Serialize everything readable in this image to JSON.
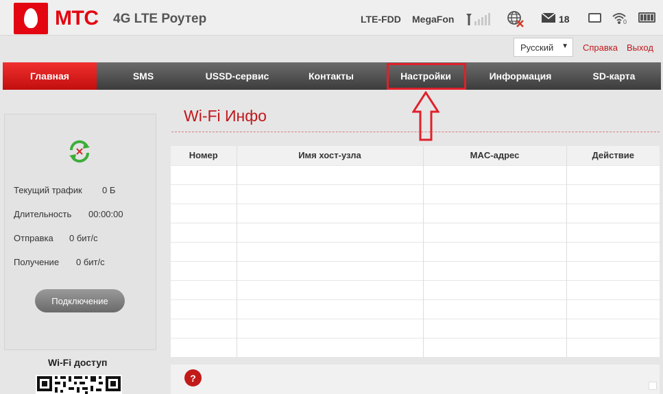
{
  "header": {
    "brand": "МТС",
    "product": "4G LTE Роутер",
    "network_type": "LTE-FDD",
    "operator": "MegaFon",
    "message_count": "18",
    "wifi_clients": "0"
  },
  "top_links": {
    "language": "Русский",
    "help": "Справка",
    "exit": "Выход"
  },
  "nav": {
    "items": [
      {
        "label": "Главная",
        "active": true
      },
      {
        "label": "SMS",
        "active": false
      },
      {
        "label": "USSD-сервис",
        "active": false
      },
      {
        "label": "Контакты",
        "active": false
      },
      {
        "label": "Настройки",
        "active": false
      },
      {
        "label": "Информация",
        "active": false
      },
      {
        "label": "SD-карта",
        "active": false
      }
    ]
  },
  "left_panel": {
    "stats": [
      {
        "label": "Текущий трафик",
        "value": "0 Б"
      },
      {
        "label": "Длительность",
        "value": "00:00:00"
      },
      {
        "label": "Отправка",
        "value": "0 бит/с"
      },
      {
        "label": "Получение",
        "value": "0 бит/с"
      }
    ],
    "connect_button": "Подключение",
    "wifi_access": "Wi-Fi доступ"
  },
  "main": {
    "title": "Wi-Fi Инфо",
    "table": {
      "columns": [
        "Номер",
        "Имя хост-узла",
        "MAC-адрес",
        "Действие"
      ],
      "rows": [
        [
          "",
          "",
          "",
          ""
        ],
        [
          "",
          "",
          "",
          ""
        ],
        [
          "",
          "",
          "",
          ""
        ],
        [
          "",
          "",
          "",
          ""
        ],
        [
          "",
          "",
          "",
          ""
        ],
        [
          "",
          "",
          "",
          ""
        ],
        [
          "",
          "",
          "",
          ""
        ],
        [
          "",
          "",
          "",
          ""
        ],
        [
          "",
          "",
          "",
          ""
        ],
        [
          "",
          "",
          "",
          ""
        ]
      ]
    },
    "help_icon_text": "?"
  },
  "colors": {
    "brand_red": "#e30611",
    "link_red": "#c0171b",
    "nav_dark": "#4a4a4a",
    "highlight": "#e0202a"
  }
}
